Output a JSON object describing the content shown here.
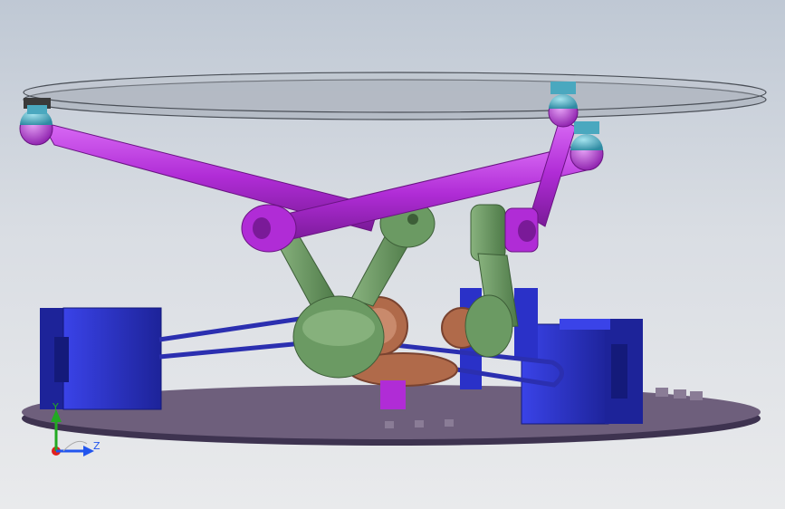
{
  "viewport": {
    "background_top": "#bfc8d4",
    "background_bottom": "#e9eaec"
  },
  "model": {
    "top_platform_color": "#9aa0ab",
    "base_plate_color": "#5e4f6a",
    "arm_color": "#b02cd6",
    "link_color": "#6b9a63",
    "motor_color": "#2a31c8",
    "gear_color": "#b06a4a",
    "ball_joint_color": "#4aa8bf",
    "belt_color": "#2b2fb0"
  },
  "triad": {
    "y_label": "Y",
    "z_label": "Z",
    "x_color": "#e02020",
    "y_color": "#22aa22",
    "z_color": "#2255ee"
  }
}
